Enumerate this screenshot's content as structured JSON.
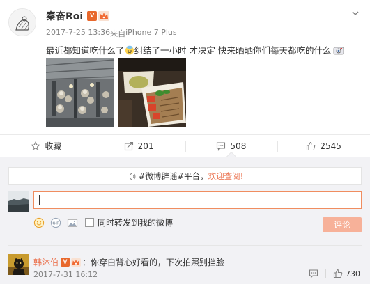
{
  "post": {
    "username": "秦奋Roi",
    "vip_badge": "V",
    "timestamp": "2017-7-25 13:36",
    "source_prefix": "来自",
    "source_device": "iPhone 7 Plus",
    "text_part1": "最近都知道吃什么了",
    "text_part2": "纠结了一小时 才决定 快来晒晒你们每天都吃的什么"
  },
  "actions": {
    "favorite_label": "收藏",
    "repost_count": "201",
    "comment_count": "508",
    "like_count": "2545"
  },
  "comment_section": {
    "notice_hashtag": "#微博辟谣#平台，",
    "notice_link": "欢迎查阅!",
    "input_value": "",
    "forward_label": "同时转发到我的微博",
    "submit_label": "评论"
  },
  "comments": [
    {
      "username": "韩沐伯",
      "vip_badge": "V",
      "text": "：你穿白背心好看的，下次拍照别挡脸",
      "time": "2017-7-31 16:12",
      "like_count": "730"
    }
  ],
  "colors": {
    "accent": "#eb7350",
    "vip": "#e8682c",
    "input_border": "#f08d60",
    "submit_bg": "#f7b199",
    "comment_bg": "#f2f2f5"
  },
  "icons": {
    "favorite": "star-outline-icon",
    "repost": "share-arrow-icon",
    "comment": "speech-bubble-icon",
    "like": "thumbs-up-icon",
    "more": "chevron-down-icon",
    "emoji": "smiley-icon",
    "gif": "gif-icon",
    "image": "picture-icon"
  }
}
